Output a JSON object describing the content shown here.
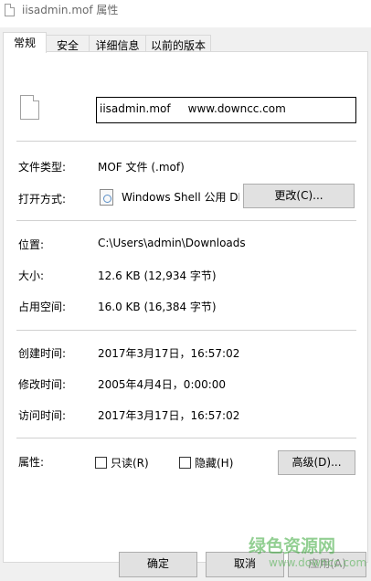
{
  "window": {
    "title": "iisadmin.mof 属性"
  },
  "tabs": [
    {
      "label": "常规",
      "active": true
    },
    {
      "label": "安全",
      "active": false
    },
    {
      "label": "详细信息",
      "active": false
    },
    {
      "label": "以前的版本",
      "active": false
    }
  ],
  "general": {
    "file_name": "iisadmin.mof     www.downcc.com",
    "file_type_label": "文件类型:",
    "file_type_value": "MOF 文件 (.mof)",
    "opens_with_label": "打开方式:",
    "opens_with_value": "Windows Shell 公用 DLL",
    "change_button": "更改(C)...",
    "location_label": "位置:",
    "location_value": "C:\\Users\\admin\\Downloads",
    "size_label": "大小:",
    "size_value": "12.6 KB (12,934 字节)",
    "size_on_disk_label": "占用空间:",
    "size_on_disk_value": "16.0 KB (16,384 字节)",
    "created_label": "创建时间:",
    "created_value": "2017年3月17日，16:57:02",
    "modified_label": "修改时间:",
    "modified_value": "2005年4月4日，0:00:00",
    "accessed_label": "访问时间:",
    "accessed_value": "2017年3月17日，16:57:02",
    "attributes_label": "属性:",
    "readonly_label": "只读(R)",
    "hidden_label": "隐藏(H)",
    "advanced_button": "高级(D)..."
  },
  "dialog_buttons": {
    "ok": "确定",
    "cancel": "取消",
    "apply": "应用(A)"
  },
  "watermark": {
    "text": "绿色资源网",
    "url": "www.downcc.com"
  }
}
